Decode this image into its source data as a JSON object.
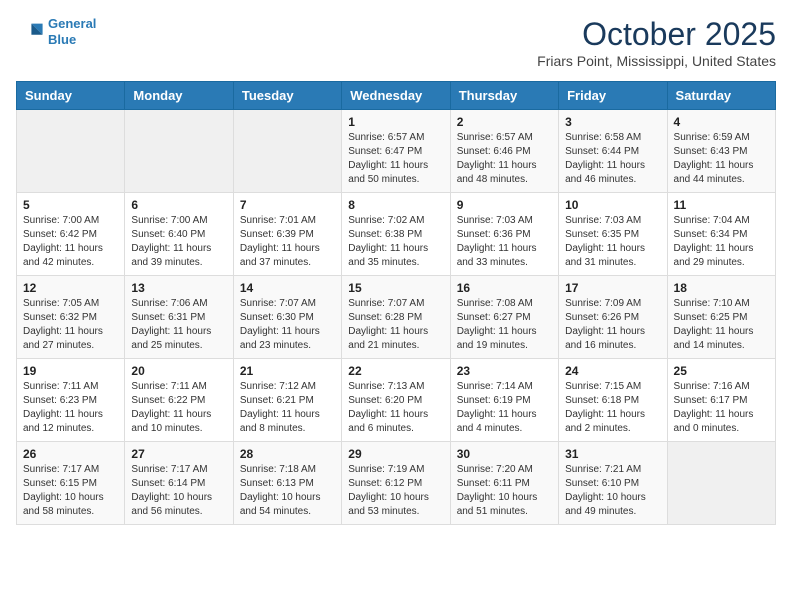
{
  "logo": {
    "line1": "General",
    "line2": "Blue"
  },
  "title": "October 2025",
  "location": "Friars Point, Mississippi, United States",
  "days_of_week": [
    "Sunday",
    "Monday",
    "Tuesday",
    "Wednesday",
    "Thursday",
    "Friday",
    "Saturday"
  ],
  "weeks": [
    [
      {
        "day": "",
        "info": ""
      },
      {
        "day": "",
        "info": ""
      },
      {
        "day": "",
        "info": ""
      },
      {
        "day": "1",
        "info": "Sunrise: 6:57 AM\nSunset: 6:47 PM\nDaylight: 11 hours\nand 50 minutes."
      },
      {
        "day": "2",
        "info": "Sunrise: 6:57 AM\nSunset: 6:46 PM\nDaylight: 11 hours\nand 48 minutes."
      },
      {
        "day": "3",
        "info": "Sunrise: 6:58 AM\nSunset: 6:44 PM\nDaylight: 11 hours\nand 46 minutes."
      },
      {
        "day": "4",
        "info": "Sunrise: 6:59 AM\nSunset: 6:43 PM\nDaylight: 11 hours\nand 44 minutes."
      }
    ],
    [
      {
        "day": "5",
        "info": "Sunrise: 7:00 AM\nSunset: 6:42 PM\nDaylight: 11 hours\nand 42 minutes."
      },
      {
        "day": "6",
        "info": "Sunrise: 7:00 AM\nSunset: 6:40 PM\nDaylight: 11 hours\nand 39 minutes."
      },
      {
        "day": "7",
        "info": "Sunrise: 7:01 AM\nSunset: 6:39 PM\nDaylight: 11 hours\nand 37 minutes."
      },
      {
        "day": "8",
        "info": "Sunrise: 7:02 AM\nSunset: 6:38 PM\nDaylight: 11 hours\nand 35 minutes."
      },
      {
        "day": "9",
        "info": "Sunrise: 7:03 AM\nSunset: 6:36 PM\nDaylight: 11 hours\nand 33 minutes."
      },
      {
        "day": "10",
        "info": "Sunrise: 7:03 AM\nSunset: 6:35 PM\nDaylight: 11 hours\nand 31 minutes."
      },
      {
        "day": "11",
        "info": "Sunrise: 7:04 AM\nSunset: 6:34 PM\nDaylight: 11 hours\nand 29 minutes."
      }
    ],
    [
      {
        "day": "12",
        "info": "Sunrise: 7:05 AM\nSunset: 6:32 PM\nDaylight: 11 hours\nand 27 minutes."
      },
      {
        "day": "13",
        "info": "Sunrise: 7:06 AM\nSunset: 6:31 PM\nDaylight: 11 hours\nand 25 minutes."
      },
      {
        "day": "14",
        "info": "Sunrise: 7:07 AM\nSunset: 6:30 PM\nDaylight: 11 hours\nand 23 minutes."
      },
      {
        "day": "15",
        "info": "Sunrise: 7:07 AM\nSunset: 6:28 PM\nDaylight: 11 hours\nand 21 minutes."
      },
      {
        "day": "16",
        "info": "Sunrise: 7:08 AM\nSunset: 6:27 PM\nDaylight: 11 hours\nand 19 minutes."
      },
      {
        "day": "17",
        "info": "Sunrise: 7:09 AM\nSunset: 6:26 PM\nDaylight: 11 hours\nand 16 minutes."
      },
      {
        "day": "18",
        "info": "Sunrise: 7:10 AM\nSunset: 6:25 PM\nDaylight: 11 hours\nand 14 minutes."
      }
    ],
    [
      {
        "day": "19",
        "info": "Sunrise: 7:11 AM\nSunset: 6:23 PM\nDaylight: 11 hours\nand 12 minutes."
      },
      {
        "day": "20",
        "info": "Sunrise: 7:11 AM\nSunset: 6:22 PM\nDaylight: 11 hours\nand 10 minutes."
      },
      {
        "day": "21",
        "info": "Sunrise: 7:12 AM\nSunset: 6:21 PM\nDaylight: 11 hours\nand 8 minutes."
      },
      {
        "day": "22",
        "info": "Sunrise: 7:13 AM\nSunset: 6:20 PM\nDaylight: 11 hours\nand 6 minutes."
      },
      {
        "day": "23",
        "info": "Sunrise: 7:14 AM\nSunset: 6:19 PM\nDaylight: 11 hours\nand 4 minutes."
      },
      {
        "day": "24",
        "info": "Sunrise: 7:15 AM\nSunset: 6:18 PM\nDaylight: 11 hours\nand 2 minutes."
      },
      {
        "day": "25",
        "info": "Sunrise: 7:16 AM\nSunset: 6:17 PM\nDaylight: 11 hours\nand 0 minutes."
      }
    ],
    [
      {
        "day": "26",
        "info": "Sunrise: 7:17 AM\nSunset: 6:15 PM\nDaylight: 10 hours\nand 58 minutes."
      },
      {
        "day": "27",
        "info": "Sunrise: 7:17 AM\nSunset: 6:14 PM\nDaylight: 10 hours\nand 56 minutes."
      },
      {
        "day": "28",
        "info": "Sunrise: 7:18 AM\nSunset: 6:13 PM\nDaylight: 10 hours\nand 54 minutes."
      },
      {
        "day": "29",
        "info": "Sunrise: 7:19 AM\nSunset: 6:12 PM\nDaylight: 10 hours\nand 53 minutes."
      },
      {
        "day": "30",
        "info": "Sunrise: 7:20 AM\nSunset: 6:11 PM\nDaylight: 10 hours\nand 51 minutes."
      },
      {
        "day": "31",
        "info": "Sunrise: 7:21 AM\nSunset: 6:10 PM\nDaylight: 10 hours\nand 49 minutes."
      },
      {
        "day": "",
        "info": ""
      }
    ]
  ]
}
